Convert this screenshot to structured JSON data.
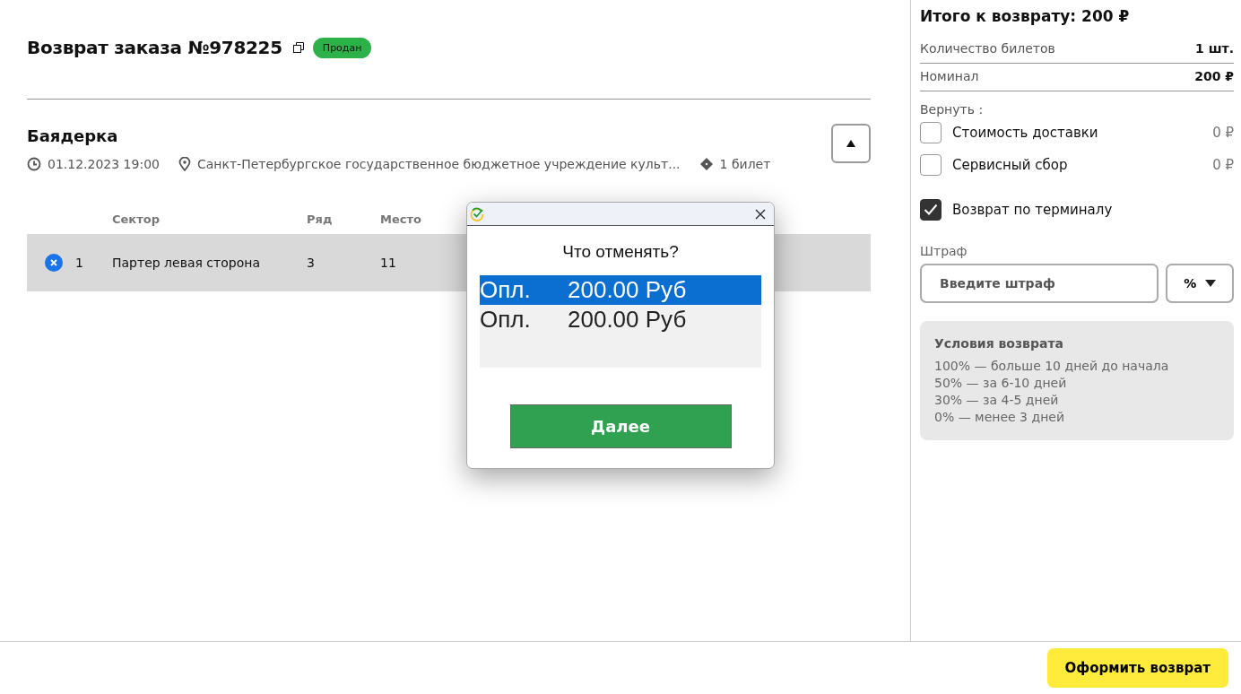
{
  "order": {
    "title": "Возврат заказа №978225",
    "status": "Продан"
  },
  "event": {
    "title": "Баядерка",
    "expanded": true,
    "date": "01.12.2023 19:00",
    "venue": "Санкт-Петербургское государственное бюджетное учреждение культ...",
    "tickets": "1 билет"
  },
  "table": {
    "columns": [
      "Сектор",
      "Ряд",
      "Место"
    ],
    "rows": [
      {
        "number": "1",
        "cells": [
          "Партер левая сторона",
          "3",
          "11"
        ]
      }
    ]
  },
  "summary": {
    "title": "Итого к возврату: 200 ₽",
    "lines": [
      {
        "label": "Количество билетов",
        "value": "1 шт."
      },
      {
        "label": "Номинал",
        "value": "200 ₽"
      }
    ],
    "return_label": "Вернуть :",
    "options": [
      {
        "label": "Стоимость доставки",
        "value": "0 ₽",
        "checked": false
      },
      {
        "label": "Сервисный сбор",
        "value": "0 ₽",
        "checked": false
      }
    ],
    "terminal": {
      "label": "Возврат по терминалу",
      "checked": true
    },
    "fine": {
      "label": "Штраф",
      "placeholder": "Введите штраф",
      "unit": "%"
    },
    "conditions": {
      "title": "Условия возврата",
      "lines": [
        "100% — больше 10 дней до начала",
        "50% — за 6-10 дней",
        "30% — за 4-5 дней",
        "0% — менее 3 дней"
      ]
    }
  },
  "footer": {
    "submit": "Оформить возврат"
  },
  "dialog": {
    "question": "Что отменять?",
    "items": [
      {
        "type": "Опл.",
        "amount": "200.00 Руб",
        "selected": true
      },
      {
        "type": "Опл.",
        "amount": "200.00 Руб",
        "selected": false
      }
    ],
    "button": "Далее"
  }
}
